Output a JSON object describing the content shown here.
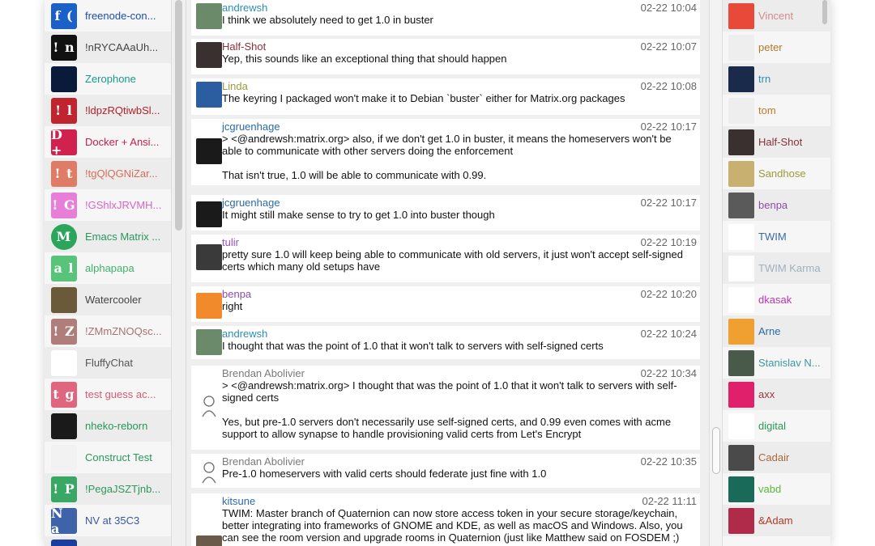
{
  "rooms": [
    {
      "name": "freenode-con...",
      "avatar_text": "f (",
      "avatar_bg": "#1b5fc9",
      "color": "#1a4fb0"
    },
    {
      "name": "!nRYCAAaUh...",
      "avatar_text": "! n",
      "avatar_bg": "#111111",
      "color": "#444444"
    },
    {
      "name": "Zerophone",
      "avatar_text": "",
      "avatar_bg": "#0a1a3a",
      "color": "#1a9a8a"
    },
    {
      "name": "!ldpzRQtiwbSl...",
      "avatar_text": "! l",
      "avatar_bg": "#c0252f",
      "color": "#b3202a"
    },
    {
      "name": "Docker + Ansi...",
      "avatar_text": "D +",
      "avatar_bg": "#d0214f",
      "color": "#c81e4a"
    },
    {
      "name": "!tgQlQGNiZar...",
      "avatar_text": "! t",
      "avatar_bg": "#e07b65",
      "color": "#d86e55"
    },
    {
      "name": "!GShlxJRVMH...",
      "avatar_text": "! G",
      "avatar_bg": "#e77fd9",
      "color": "#d864c8"
    },
    {
      "name": "Emacs Matrix ...",
      "avatar_text": "M",
      "avatar_bg": "#2aa55a",
      "color": "#26995a"
    },
    {
      "name": "alphapapa",
      "avatar_text": "a l",
      "avatar_bg": "#58c47a",
      "color": "#3fb36a"
    },
    {
      "name": "Watercooler",
      "avatar_text": "",
      "avatar_bg": "#6a5a3a",
      "color": "#444444"
    },
    {
      "name": "!ZMmZNOQsc...",
      "avatar_text": "! Z",
      "avatar_bg": "#b07e7a",
      "color": "#a87470"
    },
    {
      "name": "FluffyChat",
      "avatar_text": "",
      "avatar_bg": "#ffffff",
      "color": "#555555"
    },
    {
      "name": "test guess ac...",
      "avatar_text": "t g",
      "avatar_bg": "#e0667f",
      "color": "#d85a72"
    },
    {
      "name": "nheko-reborn",
      "avatar_text": "",
      "avatar_bg": "#1a1a1a",
      "color": "#26995a"
    },
    {
      "name": "Construct Test",
      "avatar_text": "",
      "avatar_bg": "#f2f2f2",
      "color": "#26995a"
    },
    {
      "name": "!PegaJSZTjnb...",
      "avatar_text": "! P",
      "avatar_bg": "#3aa865",
      "color": "#2e9858"
    },
    {
      "name": "NV at 35C3",
      "avatar_text": "N a",
      "avatar_bg": "#3f63a8",
      "color": "#3a58a0"
    },
    {
      "name": "",
      "avatar_text": "",
      "avatar_bg": "#1a3ea0",
      "color": "#444444"
    }
  ],
  "messages": [
    {
      "sender": "andrewsh",
      "sender_color": "#2b8fb4",
      "time": "02-22 10:04",
      "body": "I think we absolutely need to get 1.0 in buster",
      "avatar_bg": "#6a8a6a"
    },
    {
      "sender": "Half-Shot",
      "sender_color": "#8b2f3a",
      "time": "02-22 10:07",
      "body": "Yep, this sounds like an exceptional thing that should happen",
      "avatar_bg": "#3a3030"
    },
    {
      "sender": "Linda",
      "sender_color": "#9c9a3a",
      "time": "02-22 10:08",
      "body": "The keyring I packaged won't make it to Debian `buster` either for Matrix.org packages",
      "avatar_bg": "#2a5ea0"
    },
    {
      "sender": "jcgruenhage",
      "sender_color": "#2b6aa8",
      "time": "02-22 10:17",
      "body": "> <@andrewsh:matrix.org> also, if we don't get 1.0 in buster, it means the homeservers won't be able to communicate with other servers doing the enforcement\n\nThat isn't true, 1.0 will be able to communicate with 0.99.",
      "avatar_bg": "#1a1a1a"
    },
    {
      "sender": "jcgruenhage",
      "sender_color": "#2b6aa8",
      "time": "02-22 10:17",
      "body": "It might still make sense to try to get 1.0 into buster though",
      "avatar_bg": "#1a1a1a"
    },
    {
      "sender": "tulir",
      "sender_color": "#9a4fc8",
      "time": "02-22 10:19",
      "body": "pretty sure 1.0 will keep being able to communicate with old servers, it just won't accept self-signed certs which many old setups have",
      "avatar_bg": "#3a3a3a"
    },
    {
      "sender": "benpa",
      "sender_color": "#8a4fa8",
      "time": "02-22 10:20",
      "body": "right",
      "avatar_bg": "#f08a2a"
    },
    {
      "sender": "andrewsh",
      "sender_color": "#2b8fb4",
      "time": "02-22 10:24",
      "body": "I thought that was the point of 1.0 that it won't talk to servers with self-signed certs",
      "avatar_bg": "#6a8a6a"
    },
    {
      "sender": "Brendan Abolivier",
      "sender_color": "#7a7a7a",
      "time": "02-22 10:34",
      "body": "> <@andrewsh:matrix.org> I thought that was the point of 1.0 that it won't talk to servers with self-signed certs\n\nYes, but pre-1.0 servers don't necessarily use self-signed certs, and 0.99 even comes with acme support to allow synapse to handle provisioning valid certs from Let's Encrypt",
      "avatar_bg": "#ffffff"
    },
    {
      "sender": "Brendan Abolivier",
      "sender_color": "#7a7a7a",
      "time": "02-22 10:35",
      "body": "Pre-1.0 homeservers with valid certs should federate just fine with 1.0",
      "avatar_bg": "#ffffff"
    },
    {
      "sender": "kitsune",
      "sender_color": "#2b6aa8",
      "time": "02-22 11:11",
      "body": "TWIM: Master branch of Quaternion can now store access token in your secure storage/keychain, better integrating into frameworks of GNOME and KDE, as well as macOS and Windows. Also, you can see the room version and upgrade rooms in Quaternion (just like Matthew said on FOSDEM ;)",
      "avatar_bg": "#6a5a4a"
    }
  ],
  "members": [
    {
      "name": "Vincent",
      "color": "#d58a8a",
      "avatar_bg": "#e84a3a"
    },
    {
      "name": "peter",
      "color": "#b07a2a",
      "avatar_bg": "#eeeeee"
    },
    {
      "name": "trn",
      "color": "#2b8fb4",
      "avatar_bg": "#1a2a4a"
    },
    {
      "name": "tom",
      "color": "#c47a2a",
      "avatar_bg": "#eeeeee"
    },
    {
      "name": "Half-Shot",
      "color": "#8b2f3a",
      "avatar_bg": "#3a3030"
    },
    {
      "name": "Sandhose",
      "color": "#9c9a3a",
      "avatar_bg": "#c8b070"
    },
    {
      "name": "benpa",
      "color": "#8a4fa8",
      "avatar_bg": "#5a5a5a"
    },
    {
      "name": "TWIM",
      "color": "#3a6aa8",
      "avatar_bg": "#ffffff"
    },
    {
      "name": "TWIM Karma",
      "color": "#a0b0c0",
      "avatar_bg": "#ffffff"
    },
    {
      "name": "dkasak",
      "color": "#b838b0",
      "avatar_bg": "#ffffff"
    },
    {
      "name": "Arne",
      "color": "#2b6aa8",
      "avatar_bg": "#f0a030"
    },
    {
      "name": "Stanislav N...",
      "color": "#3a9aa0",
      "avatar_bg": "#4a5a4a"
    },
    {
      "name": "axx",
      "color": "#9a3a3a",
      "avatar_bg": "#e0206a"
    },
    {
      "name": "digital",
      "color": "#26995a",
      "avatar_bg": "#ffffff"
    },
    {
      "name": "Cadair",
      "color": "#a86a3a",
      "avatar_bg": "#4a4a4a"
    },
    {
      "name": "vabd",
      "color": "#58b838",
      "avatar_bg": "#1a6a5a"
    },
    {
      "name": "&Adam",
      "color": "#b03a2a",
      "avatar_bg": "#b02a4a"
    }
  ]
}
